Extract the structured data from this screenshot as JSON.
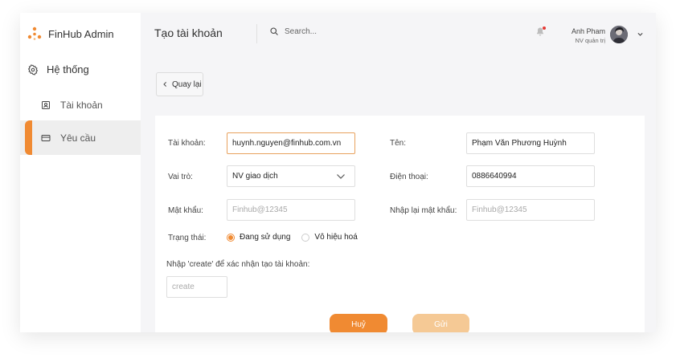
{
  "app": {
    "name": "FinHub Admin",
    "brand_color": "#f08a32"
  },
  "sidebar": {
    "group_label": "Hệ thống",
    "items": [
      {
        "label": "Tài khoản",
        "icon": "user-card-icon",
        "active": false
      },
      {
        "label": "Yêu cầu",
        "icon": "credit-card-icon",
        "active": true
      }
    ]
  },
  "header": {
    "title": "Tạo tài khoản",
    "search_placeholder": "Search...",
    "user": {
      "name": "Anh Pham",
      "role": "NV quản trị"
    },
    "has_notification": true
  },
  "back_button": {
    "label": "Quay lại"
  },
  "form": {
    "account_label": "Tài khoản:",
    "account_value": "huynh.nguyen@finhub.com.vn",
    "name_label": "Tên:",
    "name_value": "Phạm Văn Phương Huỳnh",
    "role_label": "Vai trò:",
    "role_value": "NV giao dịch",
    "phone_label": "Điện thoại:",
    "phone_value": "0886640994",
    "password_label": "Mật khẩu:",
    "password_placeholder": "Finhub@12345",
    "confirm_password_label": "Nhập lại mật khẩu:",
    "confirm_password_placeholder": "Finhub@12345",
    "status_label": "Trạng thái:",
    "status_options": [
      {
        "label": "Đang sử dụng",
        "selected": true
      },
      {
        "label": "Vô hiệu hoá",
        "selected": false
      }
    ],
    "confirm_instruction": "Nhập 'create' để xác nhận tạo tài khoản:",
    "confirm_placeholder": "create",
    "cancel_label": "Huỷ",
    "submit_label": "Gửi"
  }
}
